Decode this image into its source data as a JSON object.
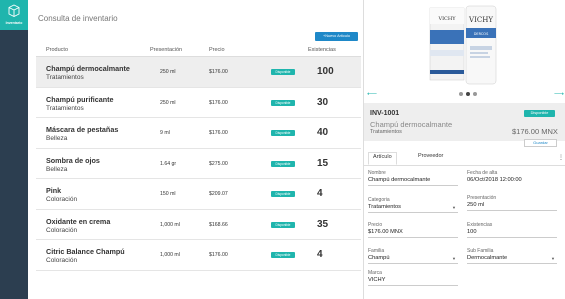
{
  "app": {
    "logo_label": "Inventario"
  },
  "page": {
    "title": "Consulta de inventario",
    "new_button": "+Nuevo Artículo"
  },
  "table": {
    "headers": {
      "product": "Producto",
      "presentation": "Presentación",
      "price": "Precio",
      "stock": "Existencias"
    },
    "rows": [
      {
        "name": "Champú dermocalmante",
        "category": "Tratamientos",
        "presentation": "250 ml",
        "price": "$176.00",
        "status": "Disponible",
        "stock": "100"
      },
      {
        "name": "Champú purificante",
        "category": "Tratamientos",
        "presentation": "250 ml",
        "price": "$176.00",
        "status": "Disponible",
        "stock": "30"
      },
      {
        "name": "Máscara de pestañas",
        "category": "Belleza",
        "presentation": "9 ml",
        "price": "$176.00",
        "status": "Disponible",
        "stock": "40"
      },
      {
        "name": "Sombra de ojos",
        "category": "Belleza",
        "presentation": "1.64 gr",
        "price": "$275.00",
        "status": "Disponible",
        "stock": "15"
      },
      {
        "name": "Pink",
        "category": "Coloración",
        "presentation": "150 ml",
        "price": "$209.07",
        "status": "Disponible",
        "stock": "4"
      },
      {
        "name": "Oxidante en crema",
        "category": "Coloración",
        "presentation": "1,000 ml",
        "price": "$168.66",
        "status": "Disponible",
        "stock": "35"
      },
      {
        "name": "Citric Balance Champú",
        "category": "Coloración",
        "presentation": "1,000 ml",
        "price": "$176.00",
        "status": "Disponible",
        "stock": "4"
      }
    ]
  },
  "detail": {
    "image_brand": "VICHY",
    "image_brand_small": "VICHY",
    "image_product": "DERCOS",
    "sku": "INV-1001",
    "status": "Disponible",
    "name": "Champú dermocalmante",
    "category": "Tratamientos",
    "price": "$176.00 MNX",
    "save_button": "Guardar",
    "tabs": [
      "Artículo",
      "Proveedor"
    ],
    "fields": {
      "name_label": "Nombre",
      "name_value": "Champú dermocalmante",
      "date_label": "Fecha de alta",
      "date_value": "06/Oct/2018 12:00:00",
      "category_label": "Categoria",
      "category_value": "Tratamientos",
      "presentation_label": "Presentación",
      "presentation_value": "250 ml",
      "price_label": "Precio",
      "price_value": "$176.00 MNX",
      "stock_label": "Existencias",
      "stock_value": "100",
      "family_label": "Familia",
      "family_value": "Champú",
      "subfamily_label": "Sub Familia",
      "subfamily_value": "Dermocalmante",
      "brand_label": "Marca",
      "brand_value": "VICHY"
    }
  },
  "colors": {
    "sidebar": "#2c3e50",
    "accent": "#1fb5ad",
    "primary_button": "#1e88c8"
  }
}
